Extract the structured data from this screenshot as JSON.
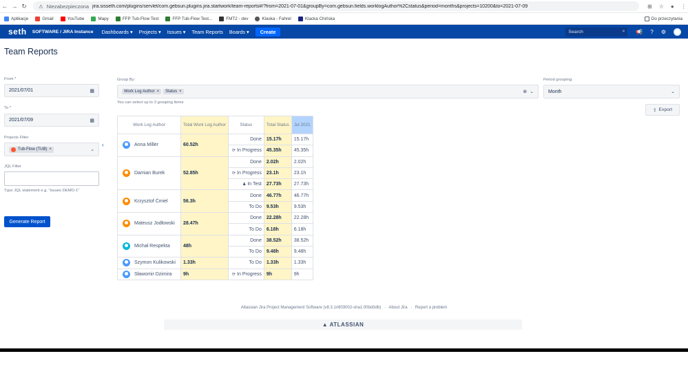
{
  "browser": {
    "insecure_label": "Niezabezpieczona",
    "url": "jira.sisseth.com/plugins/servlet/com.gebsun.plugins.jira.startwork/team-reports#/?from=2021-07-01&groupBy=com.gebsun.fields.worklogAuthor%2Cstatus&period=months&projects=10200&to=2021-07-09",
    "bookmarks": [
      "Aplikacje",
      "Gmail",
      "YouTube",
      "Mapy",
      "FFP Tub-Flow Test",
      "FFP Tub-Flow Test...",
      "FMT2 - dev",
      "Klaska - Fahrel",
      "Klacka Chińska"
    ],
    "reading_list": "Do przeczytania"
  },
  "jira": {
    "logo": "seth",
    "instance": "SOFTWARE / JIRA Instance",
    "nav": [
      "Dashboards ▾",
      "Projects ▾",
      "Issues ▾",
      "Team Reports",
      "Boards ▾"
    ],
    "create": "Create",
    "search_placeholder": "Search"
  },
  "page": {
    "title": "Team Reports",
    "export": "Export",
    "from_label": "From *",
    "from_value": "2021/07/01",
    "to_label": "To *",
    "to_value": "2021/07/09",
    "projects_label": "Projects Filter",
    "project_tag": "Tub-Flow (TUB)",
    "jql_label": "JQL Filter",
    "jql_hint": "Type JQL statement e.g. \"issues DEMO-1\"",
    "generate": "Generate Report",
    "group_by_label": "Group By:",
    "group_tags": [
      "Work Log Author",
      "Status"
    ],
    "group_hint": "You can select up to 3 grouping items",
    "period_label": "Period grouping:",
    "period_value": "Month"
  },
  "table": {
    "headers": {
      "author": "Work Log Author",
      "total_author": "Total Work Log Author",
      "status": "Status",
      "total_status": "Total Status",
      "period": "Jul 2021"
    },
    "rows": [
      {
        "author": "Anna Miller",
        "avatar_color": "#4c9aff",
        "total": "60.52h",
        "entries": [
          {
            "status": "Done",
            "icon": "",
            "total": "15.17h",
            "jul": "15.17h"
          },
          {
            "status": "In Progress",
            "icon": "⟳",
            "total": "45.35h",
            "jul": "45.35h"
          }
        ]
      },
      {
        "author": "Damian Burek",
        "avatar_color": "#ff8b00",
        "total": "52.85h",
        "entries": [
          {
            "status": "Done",
            "icon": "",
            "total": "2.02h",
            "jul": "2.02h"
          },
          {
            "status": "In Progress",
            "icon": "⟳",
            "total": "23.1h",
            "jul": "23.1h"
          },
          {
            "status": "In Test",
            "icon": "♟",
            "total": "27.73h",
            "jul": "27.73h"
          }
        ]
      },
      {
        "author": "Krzysztof Ćmiel",
        "avatar_color": "#ff8b00",
        "total": "56.3h",
        "entries": [
          {
            "status": "Done",
            "icon": "",
            "total": "46.77h",
            "jul": "46.77h"
          },
          {
            "status": "To Do",
            "icon": "",
            "total": "9.53h",
            "jul": "9.53h"
          }
        ]
      },
      {
        "author": "Mateusz Jodłowski",
        "avatar_color": "#ff8b00",
        "total": "28.47h",
        "entries": [
          {
            "status": "Done",
            "icon": "",
            "total": "22.28h",
            "jul": "22.28h"
          },
          {
            "status": "To Do",
            "icon": "",
            "total": "6.18h",
            "jul": "6.18h"
          }
        ]
      },
      {
        "author": "Michał Respekta",
        "avatar_color": "#00b8d9",
        "total": "48h",
        "entries": [
          {
            "status": "Done",
            "icon": "",
            "total": "38.52h",
            "jul": "38.52h"
          },
          {
            "status": "To Do",
            "icon": "",
            "total": "9.48h",
            "jul": "9.48h"
          }
        ]
      },
      {
        "author": "Szymon Kulikowski",
        "avatar_color": "#4c9aff",
        "total": "1.33h",
        "entries": [
          {
            "status": "To Do",
            "icon": "",
            "total": "1.33h",
            "jul": "1.33h"
          }
        ]
      },
      {
        "author": "Sławomir Dzimira",
        "avatar_color": "#4c9aff",
        "total": "9h",
        "entries": [
          {
            "status": "In Progress",
            "icon": "⟳",
            "total": "9h",
            "jul": "9h"
          }
        ]
      }
    ]
  },
  "footer": {
    "software": "Atlassian Jira Project Management Software (v8.3.1#803002-sha1:00bd3db)",
    "about": "About Jira",
    "report": "Report a problem",
    "brand": "▲ ATLASSIAN"
  }
}
